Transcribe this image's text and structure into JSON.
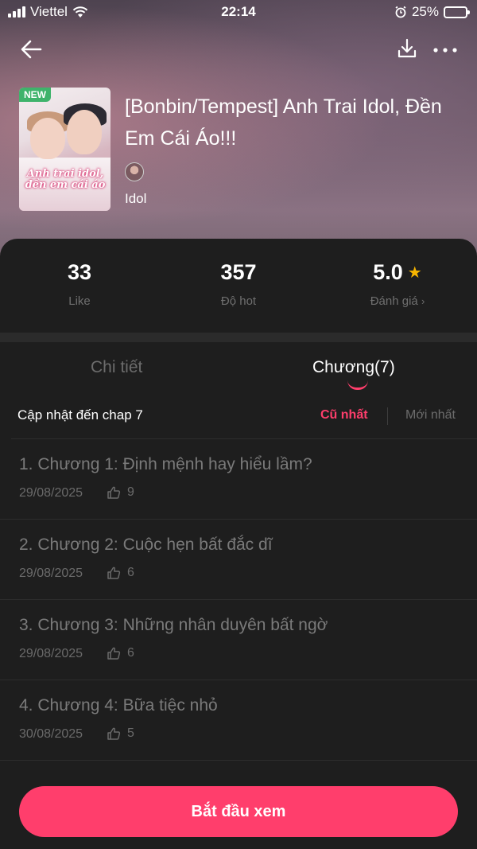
{
  "status_bar": {
    "carrier": "Viettel",
    "time": "22:14",
    "battery": "25%",
    "battery_level": 0.25
  },
  "book": {
    "cover_badge": "NEW",
    "cover_title": "Anh trai idol, đền em cái áo",
    "title": "[Bonbin/Tempest] Anh Trai Idol, Đền Em Cái Áo!!!",
    "tag": "Idol"
  },
  "stats": [
    {
      "value": "33",
      "label": "Like"
    },
    {
      "value": "357",
      "label": "Độ hot"
    },
    {
      "value": "5.0",
      "label": "Đánh giá"
    }
  ],
  "tabs": {
    "detail": "Chi tiết",
    "chapters": "Chương(7)"
  },
  "sort": {
    "updated": "Cập nhật đến chap 7",
    "oldest": "Cũ nhất",
    "newest": "Mới nhất"
  },
  "chapters": [
    {
      "title": "1. Chương 1: Định mệnh hay hiểu lầm?",
      "date": "29/08/2025",
      "likes": "9"
    },
    {
      "title": "2. Chương 2: Cuộc hẹn bất đắc dĩ",
      "date": "29/08/2025",
      "likes": "6"
    },
    {
      "title": "3. Chương 3: Những nhân duyên bất ngờ",
      "date": "29/08/2025",
      "likes": "6"
    },
    {
      "title": "4. Chương 4: Bữa tiệc nhỏ",
      "date": "30/08/2025",
      "likes": "5"
    }
  ],
  "cta": "Bắt đầu xem",
  "colors": {
    "accent": "#ff3e6c",
    "star": "#f7b500",
    "badge": "#3fb36b"
  }
}
